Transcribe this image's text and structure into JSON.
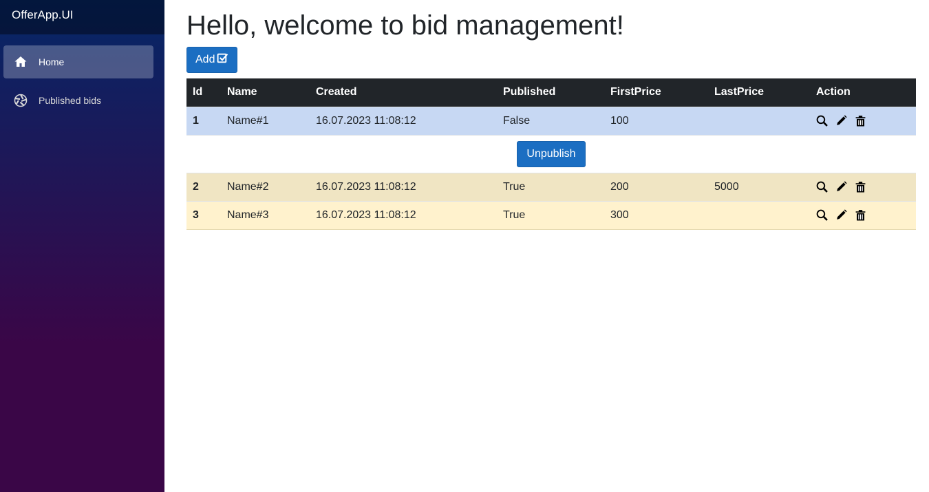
{
  "brand": "OfferApp.UI",
  "nav": [
    {
      "label": "Home",
      "icon": "home-icon",
      "active": true
    },
    {
      "label": "Published bids",
      "icon": "aperture-icon",
      "active": false
    }
  ],
  "page": {
    "title": "Hello, welcome to bid management!",
    "add_label": "Add"
  },
  "table": {
    "headers": [
      "Id",
      "Name",
      "Created",
      "Published",
      "FirstPrice",
      "LastPrice",
      "Action"
    ],
    "rows": [
      {
        "id": "1",
        "name": "Name#1",
        "created": "16.07.2023 11:08:12",
        "published": "False",
        "first_price": "100",
        "last_price": ""
      },
      {
        "id": "2",
        "name": "Name#2",
        "created": "16.07.2023 11:08:12",
        "published": "True",
        "first_price": "200",
        "last_price": "5000"
      },
      {
        "id": "3",
        "name": "Name#3",
        "created": "16.07.2023 11:08:12",
        "published": "True",
        "first_price": "300",
        "last_price": ""
      }
    ],
    "unpublish_label": "Unpublish"
  },
  "colors": {
    "accent": "#1b6ec2",
    "header_bg": "#212529",
    "row_selected": "#c7d8f3",
    "row_published_alt": "#f0e5c3",
    "row_published": "#fff2cd"
  }
}
